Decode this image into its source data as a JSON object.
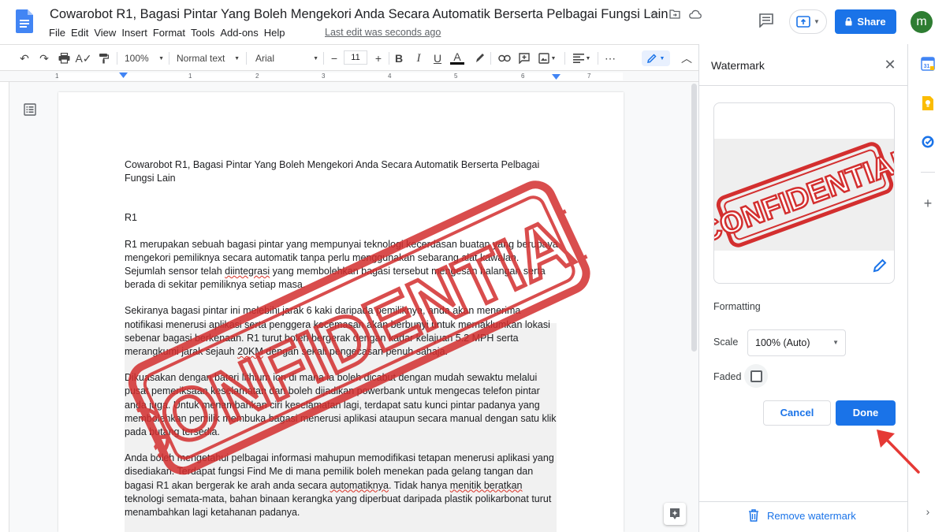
{
  "header": {
    "title": "Cowarobot R1, Bagasi Pintar Yang Boleh Mengekori Anda Secara Automatik Berserta Pelbagai Fungsi Lain",
    "menu": [
      "File",
      "Edit",
      "View",
      "Insert",
      "Format",
      "Tools",
      "Add-ons",
      "Help"
    ],
    "last_edit": "Last edit was seconds ago",
    "share_label": "Share",
    "avatar_letter": "m"
  },
  "toolbar": {
    "zoom": "100%",
    "style": "Normal text",
    "font": "Arial",
    "font_size": "11",
    "minus": "−",
    "plus": "+",
    "bold": "B",
    "italic": "I",
    "underline": "U",
    "text_color": "A",
    "more": "⋯"
  },
  "ruler": {
    "numbers": [
      "1",
      "1",
      "2",
      "3",
      "4",
      "5",
      "6",
      "7"
    ]
  },
  "document": {
    "title_line": "Cowarobot R1, Bagasi Pintar Yang Boleh Mengekori Anda Secara Automatik Berserta Pelbagai Fungsi Lain",
    "heading": "R1",
    "p1_a": "R1 merupakan sebuah bagasi pintar yang mempunyai teknologi kecerdasan buatan yang berupaya mengekori pemiliknya secara automatik tanpa perlu menggunakan sebarang alat kawalan. Sejumlah sensor telah ",
    "p1_err": "diintegrasi",
    "p1_b": " yang membolehkan bagasi tersebut mengesan halangan serta berada di sekitar pemiliknya setiap masa.",
    "p2_a": "Sekiranya bagasi pintar ini melebihi jarak 6 kaki daripada pemiliknya, anda akan menerima notifikasi menerusi aplikasi serta penggera kecemasan akan berbunyi untuk memaklumkan lokasi sebenar bagasi berkenaan. R1 turut boleh bergerak dengan kadar kelajuan 5.2 MPH serta merangkumi jarak sejauh ",
    "p2_err": "20KM",
    "p2_b": " dengan sekali pengecasan penuh sahaja.",
    "p3": "Dikuasakan dengan bateri lithium ion di mana ia boleh dicabut dengan mudah sewaktu melalui pusat pemeriksaan keselamatan dan boleh dijadikan powerbank untuk mengecas telefon pintar anda juga. Untuk menambahkan ciri keselamatan lagi, terdapat satu kunci pintar padanya yang membolehkan pemilik membuka bagasi menerusi aplikasi ataupun secara manual dengan satu klik pada butang tersedia.",
    "p4_a": "Anda boleh mengetahui pelbagai informasi mahupun memodifikasi tetapan menerusi aplikasi yang disediakan. Terdapat fungsi Find Me di mana pemilik boleh menekan pada gelang tangan dan bagasi R1 akan bergerak ke arah anda secara ",
    "p4_err1": "automatiknya",
    "p4_b": ". Tidak hanya ",
    "p4_err2": "menitik beratkan",
    "p4_c": " teknologi semata-mata, bahan binaan kerangka yang diperbuat daripada plastik polikarbonat turut menambahkan lagi ketahanan padanya.",
    "stamp_text": "CONFIDENTIAL"
  },
  "panel": {
    "title": "Watermark",
    "preview_stamp": "CONFIDENTIAL",
    "formatting_label": "Formatting",
    "scale_label": "Scale",
    "scale_value": "100% (Auto)",
    "faded_label": "Faded",
    "faded_checked": false,
    "cancel_label": "Cancel",
    "done_label": "Done",
    "remove_label": "Remove watermark"
  },
  "colors": {
    "accent": "#1a73e8",
    "stamp_red": "#d32f2f",
    "avatar": "#2e7d32"
  }
}
